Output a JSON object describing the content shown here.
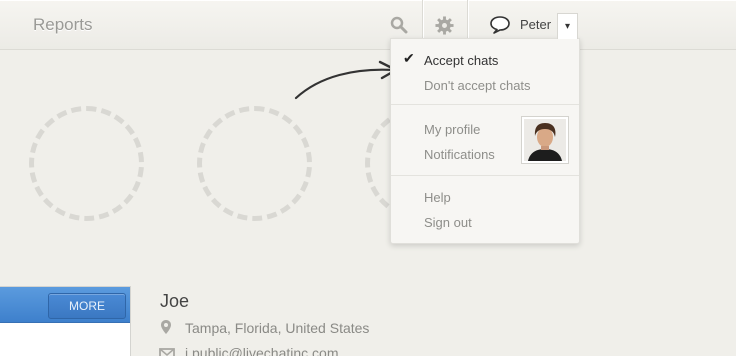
{
  "header": {
    "title": "Reports",
    "icons": [
      "search-icon",
      "gear-icon",
      "chat-bubble-icon"
    ],
    "user_name": "Peter",
    "dropdown_caret": "▾"
  },
  "dropdown": {
    "checkmark": "✔",
    "accept_chats": "Accept chats",
    "dont_accept_chats": "Don't accept chats",
    "my_profile": "My profile",
    "notifications": "Notifications",
    "help": "Help",
    "sign_out": "Sign out"
  },
  "panel": {
    "more_label": "MORE",
    "header_color": "#4a8ad5"
  },
  "visitor": {
    "name": "Joe",
    "location": "Tampa, Florida, United States",
    "email": "j.public@livechatinc.com"
  }
}
